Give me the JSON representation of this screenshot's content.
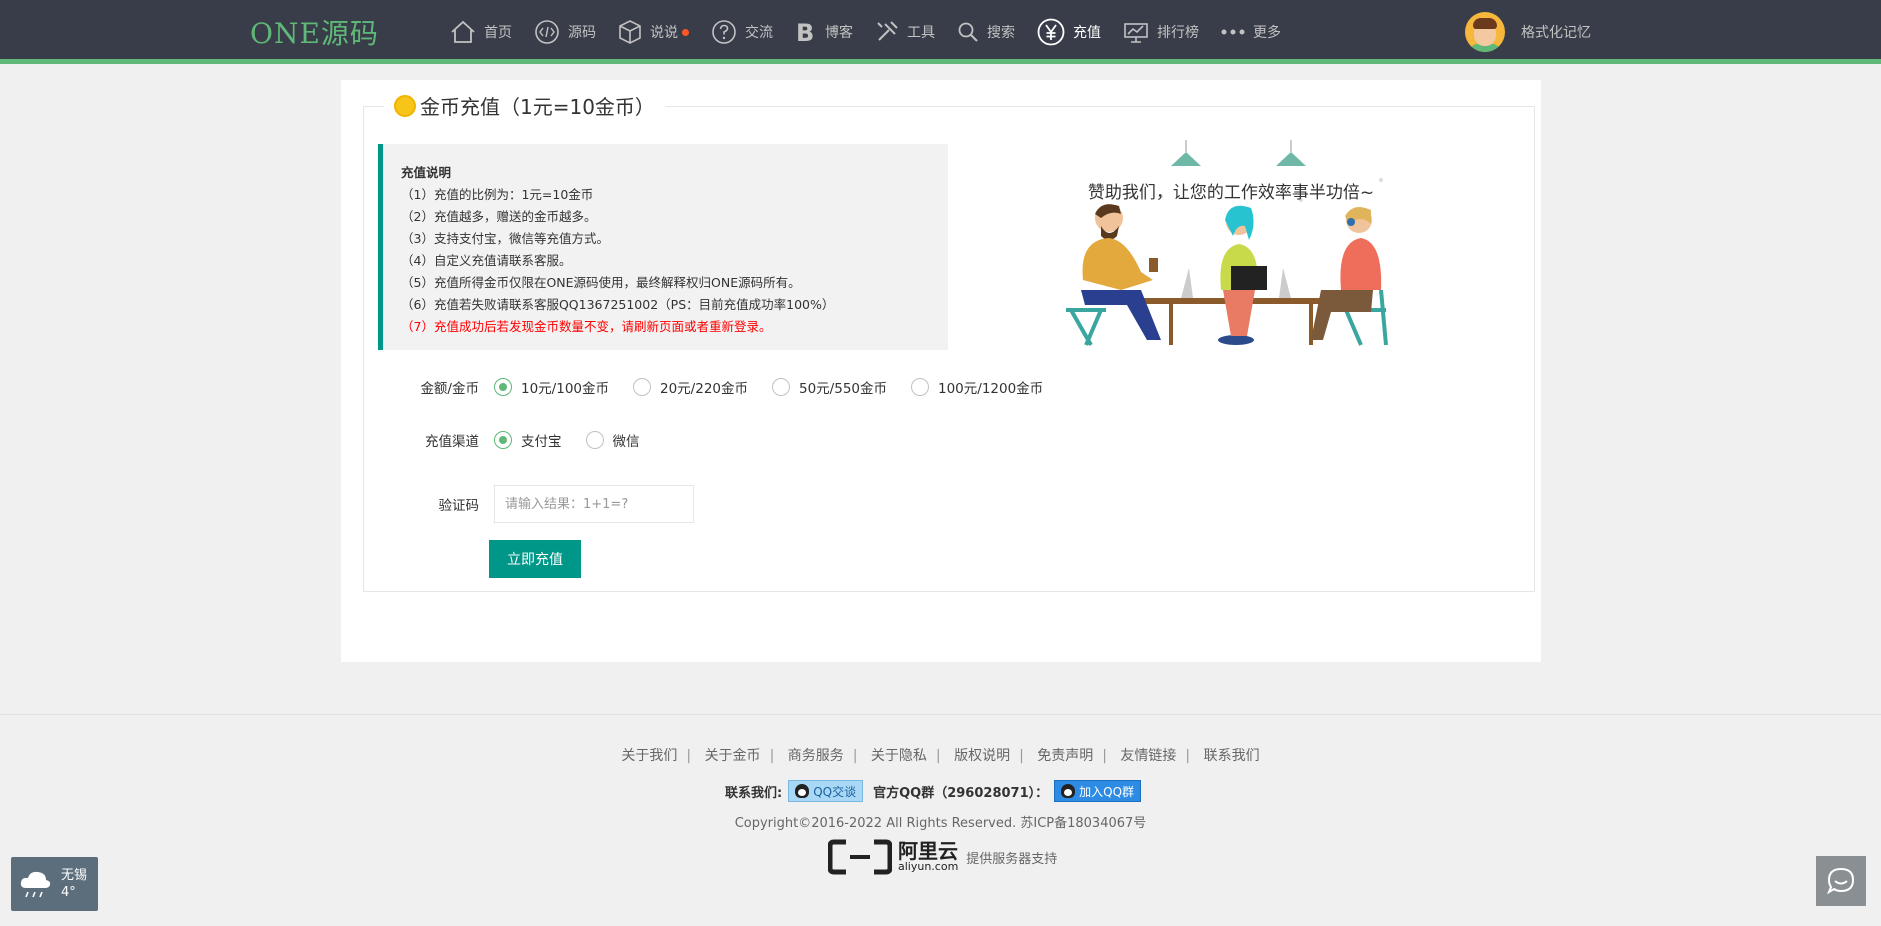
{
  "header": {
    "logo": "ONE源码",
    "nav": [
      {
        "label": "首页",
        "icon": "home-icon"
      },
      {
        "label": "源码",
        "icon": "code-icon"
      },
      {
        "label": "说说",
        "icon": "cube-icon",
        "dot": true
      },
      {
        "label": "交流",
        "icon": "question-icon"
      },
      {
        "label": "博客",
        "icon": "blog-b-icon"
      },
      {
        "label": "工具",
        "icon": "tools-icon"
      },
      {
        "label": "搜索",
        "icon": "search-icon"
      },
      {
        "label": "充值",
        "icon": "yen-icon",
        "active": true
      },
      {
        "label": "排行榜",
        "icon": "leaderboard-icon"
      },
      {
        "label": "更多",
        "icon": "more-dots-icon"
      }
    ],
    "username": "格式化记忆"
  },
  "recharge": {
    "legend": "金币充值（1元=10金币）",
    "notice_title": "充值说明",
    "notice_items": [
      "（1）充值的比例为：1元=10金币",
      "（2）充值越多，赠送的金币越多。",
      "（3）支持支付宝，微信等充值方式。",
      "（4）自定义充值请联系客服。",
      "（5）充值所得金币仅限在ONE源码使用，最终解释权归ONE源码所有。",
      "（6）充值若失败请联系客服QQ1367251002（PS：目前充值成功率100%）"
    ],
    "notice_warning": "（7）充值成功后若发现金币数量不变，请刷新页面或者重新登录。",
    "slogan": "赞助我们，让您的工作效率事半功倍~",
    "amount_label": "金额/金币",
    "amount_options": [
      "10元/100金币",
      "20元/220金币",
      "50元/550金币",
      "100元/1200金币"
    ],
    "channel_label": "充值渠道",
    "channel_options": [
      "支付宝",
      "微信"
    ],
    "captcha_label": "验证码",
    "captcha_placeholder": "请输入结果：1+1=?",
    "submit_label": "立即充值"
  },
  "footer": {
    "links": [
      "关于我们",
      "关于金币",
      "商务服务",
      "关于隐私",
      "版权说明",
      "免责声明",
      "友情链接",
      "联系我们"
    ],
    "contact_label": "联系我们:",
    "qq_chat": "QQ交谈",
    "qq_group_label": "官方QQ群（296028071）：",
    "qq_group_join": "加入QQ群",
    "copyright": "Copyright©2016-2022 All Rights Reserved. 苏ICP备18034067号",
    "aliyun_name": "阿里云",
    "aliyun_domain": "aliyun.com",
    "aliyun_support": "提供服务器支持"
  },
  "weather": {
    "city": "无锡",
    "temp": "4°",
    "icon": "rain-cloud-icon"
  },
  "colors": {
    "header_bg": "#393d49",
    "accent_green": "#5fb878",
    "button_teal": "#009688",
    "warning_red": "#ff0000"
  }
}
